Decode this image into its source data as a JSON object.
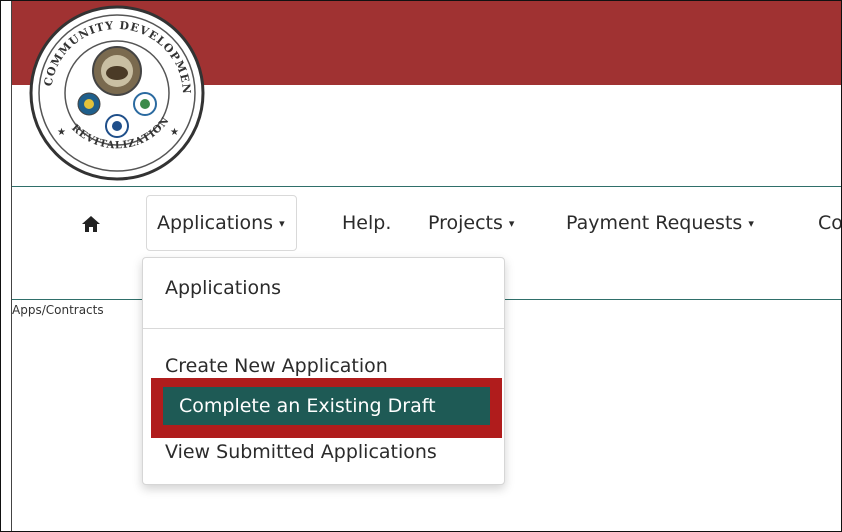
{
  "nav": {
    "home_icon": "home-icon",
    "applications": "Applications",
    "help": "Help.",
    "projects": "Projects",
    "payment_requests": "Payment Requests",
    "cutoff": "Co",
    "caret": "▾"
  },
  "breadcrumb": "Apps/Contracts",
  "dropdown": {
    "header": "Applications",
    "items": [
      "Create New Application",
      "Complete an Existing Draft",
      "View Submitted Applications"
    ]
  },
  "colors": {
    "banner": "#a03232",
    "teal": "#1e5a55",
    "highlight": "#b01c1c"
  }
}
